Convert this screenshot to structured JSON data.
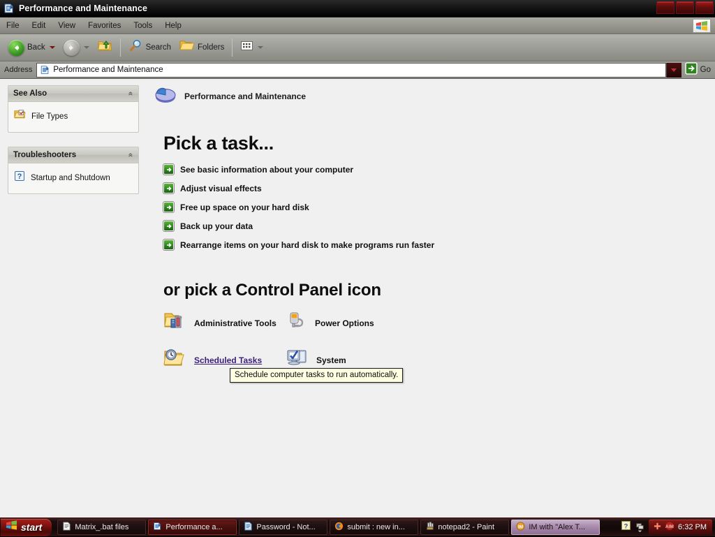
{
  "window": {
    "title": "Performance and Maintenance",
    "icon": "control-panel-category-icon",
    "buttons": {
      "minimize": "Minimize",
      "maximize": "Maximize",
      "close": "Close"
    }
  },
  "menubar": {
    "items": [
      "File",
      "Edit",
      "View",
      "Favorites",
      "Tools",
      "Help"
    ],
    "logo": "windows-flag-logo"
  },
  "toolbar": {
    "back_label": "Back",
    "forward_label": "",
    "up_label": "",
    "search_label": "Search",
    "folders_label": "Folders",
    "views_label": ""
  },
  "address": {
    "label": "Address",
    "value": "Performance and Maintenance",
    "go_label": "Go"
  },
  "sidebar": {
    "panels": [
      {
        "title": "See Also",
        "collapse_glyph": "«",
        "items": [
          {
            "label": "File Types",
            "icon": "file-types-icon"
          }
        ]
      },
      {
        "title": "Troubleshooters",
        "collapse_glyph": "«",
        "items": [
          {
            "label": "Startup and Shutdown",
            "icon": "help-question-icon"
          }
        ]
      }
    ]
  },
  "content": {
    "category_title": "Performance and Maintenance",
    "category_icon": "pie-chart-icon",
    "tasks_heading": "Pick a task...",
    "tasks": [
      "See basic information about your computer",
      "Adjust visual effects",
      "Free up space on your hard disk",
      "Back up your data",
      "Rearrange items on your hard disk to make programs run faster"
    ],
    "icons_heading": "or pick a Control Panel icon",
    "icons": [
      {
        "label": "Administrative Tools",
        "icon": "administrative-tools-icon",
        "hovered": false
      },
      {
        "label": "Power Options",
        "icon": "power-options-icon",
        "hovered": false
      },
      {
        "label": "Scheduled Tasks",
        "icon": "scheduled-tasks-icon",
        "hovered": true
      },
      {
        "label": "System",
        "icon": "system-icon",
        "hovered": false
      }
    ],
    "tooltip": "Schedule computer tasks to run automatically."
  },
  "taskbar": {
    "start_label": "start",
    "buttons": [
      {
        "label": "Matrix_.bat files",
        "icon": "notepad-icon",
        "active": false
      },
      {
        "label": "Performance a...",
        "icon": "control-panel-icon",
        "active": true
      },
      {
        "label": "Password - Not...",
        "icon": "notepad-icon",
        "active": false
      },
      {
        "label": "submit : new in...",
        "icon": "firefox-icon",
        "active": false
      },
      {
        "label": "notepad2 - Paint",
        "icon": "paint-icon",
        "active": false
      },
      {
        "label": "IM with \"Alex T...",
        "icon": "aim-icon",
        "active": false
      }
    ],
    "tray": {
      "icons": [
        "help-question-icon",
        "network-icon",
        "plus-icon",
        "aim-icon"
      ],
      "clock": "6:32 PM"
    }
  },
  "colors": {
    "accent_red": "#8e1a17",
    "green_arrow": "#2f8420",
    "link": "#3a1f7a",
    "content_bg": "#f0f0f0",
    "tooltip_bg": "#ffffe1"
  }
}
